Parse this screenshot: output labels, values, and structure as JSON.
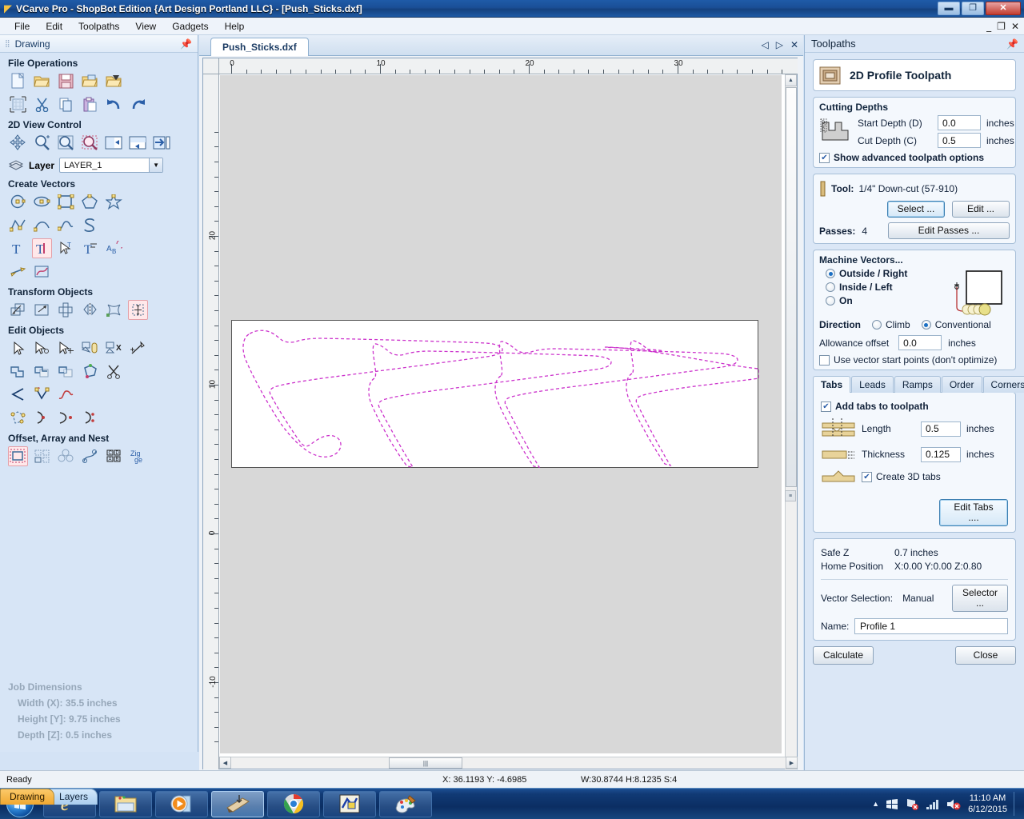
{
  "window": {
    "title": "VCarve Pro - ShopBot Edition {Art Design Portland LLC} - [Push_Sticks.dxf]",
    "app_icon": "vcarve-logo-icon",
    "minimize": "—",
    "restore": "❐",
    "close": "✕",
    "mdi_minimize": "—",
    "mdi_restore": "❐",
    "mdi_close": "✕"
  },
  "menubar": {
    "items": [
      "File",
      "Edit",
      "Toolpaths",
      "View",
      "Gadgets",
      "Help"
    ]
  },
  "drawing_panel": {
    "header": "Drawing",
    "pin_icon": "pin-icon",
    "sections": [
      {
        "title": "File Operations",
        "rows": [
          [
            "new-file-icon",
            "open-file-icon",
            "save-file-icon",
            "import-file-icon",
            "export-file-icon"
          ],
          [
            "job-setup-icon",
            "cut-icon",
            "copy-icon",
            "paste-icon",
            "undo-icon",
            "redo-icon"
          ]
        ]
      },
      {
        "title": "2D View Control",
        "rows": [
          [
            "pan-icon",
            "zoom-interactive-icon",
            "zoom-extents-icon",
            "zoom-selected-icon",
            "toggle-2d3d-icon",
            "show-drawing-tools-icon",
            "open-close-panel-icon"
          ]
        ]
      },
      {
        "title": "Create Vectors",
        "rows": [
          [
            "draw-circle-icon",
            "draw-ellipse-icon",
            "draw-rectangle-icon",
            "draw-polygon-icon",
            "draw-star-icon"
          ],
          [
            "draw-polyline-icon",
            "draw-arc-icon",
            "draw-curve-icon",
            "draw-sshape-icon"
          ],
          [
            "create-text-icon",
            "edit-text-icon",
            "text-selection-icon",
            "text-on-curve-icon",
            "auto-text-layout-icon"
          ],
          [
            "draw-dimension-icon",
            "trace-bitmap-icon"
          ]
        ]
      },
      {
        "title": "Transform Objects",
        "rows": [
          [
            "move-objects-icon",
            "scale-objects-icon",
            "align-objects-icon",
            "mirror-objects-icon",
            "distort-objects-icon",
            "center-in-job-icon"
          ]
        ]
      },
      {
        "title": "Edit Objects",
        "rows": [
          [
            "select-tool-icon",
            "node-edit-icon",
            "move-node-icon",
            "group-objects-icon",
            "ungroup-objects-icon",
            "measure-icon"
          ],
          [
            "weld-vectors-icon",
            "subtract-vectors-icon",
            "intersect-vectors-icon",
            "join-vectors-icon",
            "trim-vectors-icon"
          ],
          [
            "fillet-icon",
            "create-fillet-icon",
            "curve-fit-icon"
          ],
          [
            "close-vector-icon",
            "offset-corner-icon",
            "smooth-node-icon",
            "split-vector-icon"
          ]
        ]
      },
      {
        "title": "Offset, Array and Nest",
        "rows": [
          [
            "offset-vectors-icon",
            "block-copy-icon",
            "rotate-copy-icon",
            "copy-along-curve-icon",
            "plate-layout-icon",
            "nesting-icon"
          ]
        ]
      }
    ],
    "layer": {
      "label": "Layer",
      "icon": "layers-icon",
      "value": "LAYER_1",
      "chevron": "▼"
    },
    "job_dimensions": {
      "title": "Job Dimensions",
      "width": "Width  (X): 35.5 inches",
      "height": "Height [Y]: 9.75 inches",
      "depth": "Depth  [Z]: 0.5 inches"
    },
    "tabs": [
      {
        "label": "Drawing",
        "active": true
      },
      {
        "label": "Layers",
        "active": false
      }
    ]
  },
  "document": {
    "tab_label": "Push_Sticks.dxf",
    "nav_prev": "◁",
    "nav_next": "▷",
    "nav_close": "✕",
    "ruler_h": {
      "labels": [
        "0",
        "10",
        "20",
        "30"
      ],
      "values": [
        0,
        10,
        20,
        30
      ],
      "unit": "inches"
    },
    "ruler_v": {
      "labels": [
        "20",
        "10",
        "0",
        "-10"
      ],
      "values": [
        20,
        10,
        0,
        -10
      ]
    },
    "material_color": "#ffffff",
    "vector_color": "#cc33cc",
    "background_color": "#d8d8d8"
  },
  "toolpaths": {
    "header": "Toolpaths",
    "pin_icon": "pin-icon",
    "toolpath_type": {
      "icon": "profile-toolpath-icon",
      "title": "2D Profile Toolpath"
    },
    "cutting_depths": {
      "title": "Cutting Depths",
      "diagram_icon": "depth-diagram-icon",
      "start_depth_label": "Start Depth (D)",
      "start_depth_value": "0.0",
      "start_depth_unit": "inches",
      "cut_depth_label": "Cut Depth (C)",
      "cut_depth_value": "0.5",
      "cut_depth_unit": "inches",
      "advanced_label": "Show advanced toolpath options",
      "advanced_checked": true
    },
    "tool": {
      "icon": "tool-bit-icon",
      "label": "Tool:",
      "value": "1/4\" Down-cut (57-910)",
      "select_button": "Select ...",
      "edit_button": "Edit ...",
      "passes_label": "Passes:",
      "passes_value": "4",
      "edit_passes_button": "Edit Passes ..."
    },
    "machine_vectors": {
      "title": "Machine Vectors...",
      "options": [
        {
          "label": "Outside / Right",
          "selected": true
        },
        {
          "label": "Inside / Left",
          "selected": false
        },
        {
          "label": "On",
          "selected": false
        }
      ],
      "direction_label": "Direction",
      "directions": [
        {
          "label": "Climb",
          "selected": false
        },
        {
          "label": "Conventional",
          "selected": true
        }
      ],
      "allowance_label": "Allowance offset",
      "allowance_value": "0.0",
      "allowance_unit": "inches",
      "start_points_label": "Use vector start points (don't optimize)",
      "start_points_checked": false,
      "preview_icon": "vector-offset-preview-icon"
    },
    "tab_strip": [
      {
        "label": "Tabs",
        "active": true
      },
      {
        "label": "Leads",
        "active": false
      },
      {
        "label": "Ramps",
        "active": false
      },
      {
        "label": "Order",
        "active": false
      },
      {
        "label": "Corners",
        "active": false
      }
    ],
    "tabs_panel": {
      "add_tabs_label": "Add tabs to toolpath",
      "add_tabs_checked": true,
      "length_icon": "tab-length-icon",
      "length_label": "Length",
      "length_value": "0.5",
      "length_unit": "inches",
      "thickness_icon": "tab-thickness-icon",
      "thickness_label": "Thickness",
      "thickness_value": "0.125",
      "thickness_unit": "inches",
      "tabs3d_icon": "tab-3d-icon",
      "tabs3d_label": "Create 3D tabs",
      "tabs3d_checked": true,
      "edit_tabs_button": "Edit Tabs ...."
    },
    "position": {
      "safe_z_label": "Safe Z",
      "safe_z_value": "0.7 inches",
      "home_label": "Home Position",
      "home_value": "X:0.00 Y:0.00 Z:0.80",
      "vector_selection_label": "Vector Selection:",
      "vector_selection_value": "Manual",
      "selector_button": "Selector ...",
      "name_label": "Name:",
      "name_value": "Profile 1"
    },
    "calculate_button": "Calculate",
    "close_button": "Close"
  },
  "statusbar": {
    "message": "Ready",
    "cursor": "X: 36.1193 Y: -4.6985",
    "dimensions": "W:30.8744  H:8.1235  S:4"
  },
  "taskbar": {
    "start_icon": "windows-start-icon",
    "items": [
      {
        "icon": "internet-explorer-icon",
        "active": false
      },
      {
        "icon": "file-explorer-icon",
        "active": false
      },
      {
        "icon": "media-player-icon",
        "active": false
      },
      {
        "icon": "vcarve-pro-icon",
        "active": true
      },
      {
        "icon": "google-chrome-icon",
        "active": false
      },
      {
        "icon": "shopbot-icon",
        "active": false
      },
      {
        "icon": "paint-icon",
        "active": false
      }
    ],
    "tray": {
      "show_hidden_icon": "chevron-up-icon",
      "action_center_icon": "action-center-icon",
      "network_icon": "network-disconnected-icon",
      "signal_icon": "signal-bars-icon",
      "volume_icon": "volume-muted-icon"
    },
    "clock": {
      "time": "11:10 AM",
      "date": "6/12/2015"
    }
  }
}
